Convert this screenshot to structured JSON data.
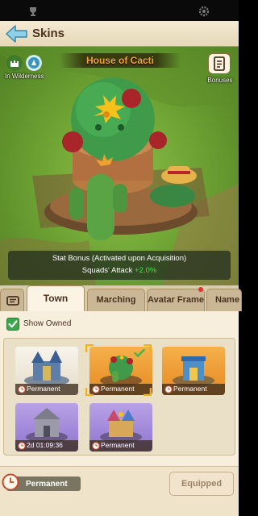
{
  "header": {
    "title": "Skins"
  },
  "scene": {
    "status_label": "In Wilderness",
    "skin_name": "House of Cacti",
    "bonuses_label": "Bonuses",
    "stat_title": "Stat Bonus (Activated upon Acquisition)",
    "stat_name": "Squads' Attack",
    "stat_value": "+2.0%"
  },
  "tabs": [
    {
      "label": "Town",
      "active": true
    },
    {
      "label": "Marching",
      "active": false
    },
    {
      "label": "Avatar Frame",
      "active": false,
      "badge": true
    },
    {
      "label": "Name",
      "active": false
    }
  ],
  "filter": {
    "show_owned_label": "Show Owned",
    "checked": true
  },
  "skins": [
    {
      "duration": "Permanent",
      "style": "white"
    },
    {
      "duration": "Permanent",
      "style": "orange",
      "selected": true,
      "equipped": true
    },
    {
      "duration": "Permanent",
      "style": "orange"
    },
    {
      "duration": "2d 01:09:36",
      "style": "purple"
    },
    {
      "duration": "Permanent",
      "style": "purple"
    }
  ],
  "footer": {
    "duration_label": "Permanent",
    "equipped_label": "Equipped"
  },
  "colors": {
    "accent_orange": "#f6a030",
    "stat_green": "#45e04a",
    "check_green": "#3aa84b"
  }
}
